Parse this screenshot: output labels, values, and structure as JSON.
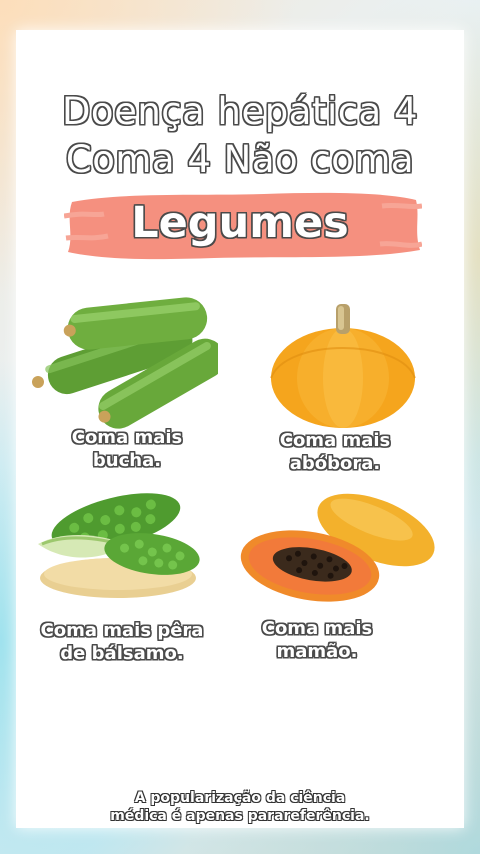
{
  "heading": {
    "line1": "Doença hepática 4",
    "line2": "Coma 4 Não coma",
    "subtitle": "Legumes"
  },
  "items": [
    {
      "label_line1": "Coma mais",
      "label_line2": "bucha.",
      "icon": "loofah-icon"
    },
    {
      "label_line1": "Coma mais",
      "label_line2": "abóbora.",
      "icon": "pumpkin-icon"
    },
    {
      "label_line1": "Coma mais pêra",
      "label_line2": "de bálsamo.",
      "icon": "bitter-melon-icon"
    },
    {
      "label_line1": "Coma mais",
      "label_line2": "mamão.",
      "icon": "papaya-icon"
    }
  ],
  "footer": {
    "line1": "A popularização da ciência",
    "line2": "médica é apenas parareferência."
  },
  "colors": {
    "brush": "#f48a78",
    "outline": "#4a4a4a",
    "loofah": "#6fae3f",
    "pumpkin": "#f5a51d",
    "bitter_melon": "#4f9b2f",
    "papaya": "#f08a2a"
  }
}
